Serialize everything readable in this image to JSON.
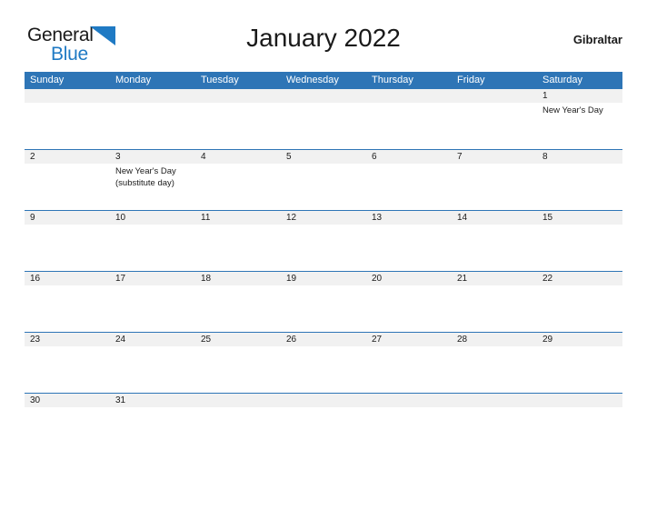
{
  "brand": {
    "name_part1": "General",
    "name_part2": "Blue",
    "mark_icon": "triangle-flag-icon",
    "color_blue": "#1f7ac4",
    "color_dark": "#1a1a1a"
  },
  "header": {
    "title": "January 2022",
    "region": "Gibraltar"
  },
  "colors": {
    "header_blue": "#2e75b6",
    "date_band_gray": "#f1f1f1",
    "row_rule_blue": "#2e75b6",
    "text": "#1a1a1a",
    "page_background": "#ffffff"
  },
  "calendar": {
    "weekdays": [
      "Sunday",
      "Monday",
      "Tuesday",
      "Wednesday",
      "Thursday",
      "Friday",
      "Saturday"
    ],
    "weeks": [
      {
        "days": [
          {
            "date": "",
            "events": []
          },
          {
            "date": "",
            "events": []
          },
          {
            "date": "",
            "events": []
          },
          {
            "date": "",
            "events": []
          },
          {
            "date": "",
            "events": []
          },
          {
            "date": "",
            "events": []
          },
          {
            "date": "1",
            "events": [
              "New Year's Day"
            ]
          }
        ]
      },
      {
        "days": [
          {
            "date": "2",
            "events": []
          },
          {
            "date": "3",
            "events": [
              "New Year's Day",
              "(substitute day)"
            ]
          },
          {
            "date": "4",
            "events": []
          },
          {
            "date": "5",
            "events": []
          },
          {
            "date": "6",
            "events": []
          },
          {
            "date": "7",
            "events": []
          },
          {
            "date": "8",
            "events": []
          }
        ]
      },
      {
        "days": [
          {
            "date": "9",
            "events": []
          },
          {
            "date": "10",
            "events": []
          },
          {
            "date": "11",
            "events": []
          },
          {
            "date": "12",
            "events": []
          },
          {
            "date": "13",
            "events": []
          },
          {
            "date": "14",
            "events": []
          },
          {
            "date": "15",
            "events": []
          }
        ]
      },
      {
        "days": [
          {
            "date": "16",
            "events": []
          },
          {
            "date": "17",
            "events": []
          },
          {
            "date": "18",
            "events": []
          },
          {
            "date": "19",
            "events": []
          },
          {
            "date": "20",
            "events": []
          },
          {
            "date": "21",
            "events": []
          },
          {
            "date": "22",
            "events": []
          }
        ]
      },
      {
        "days": [
          {
            "date": "23",
            "events": []
          },
          {
            "date": "24",
            "events": []
          },
          {
            "date": "25",
            "events": []
          },
          {
            "date": "26",
            "events": []
          },
          {
            "date": "27",
            "events": []
          },
          {
            "date": "28",
            "events": []
          },
          {
            "date": "29",
            "events": []
          }
        ]
      },
      {
        "days": [
          {
            "date": "30",
            "events": []
          },
          {
            "date": "31",
            "events": []
          },
          {
            "date": "",
            "events": []
          },
          {
            "date": "",
            "events": []
          },
          {
            "date": "",
            "events": []
          },
          {
            "date": "",
            "events": []
          },
          {
            "date": "",
            "events": []
          }
        ]
      }
    ]
  }
}
